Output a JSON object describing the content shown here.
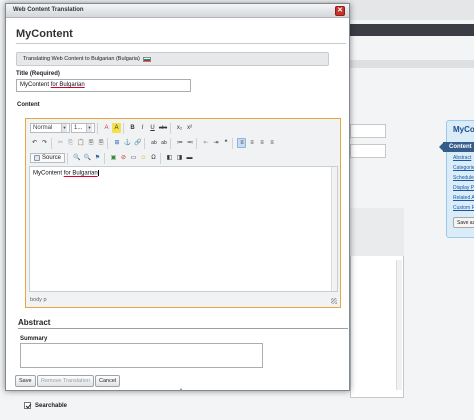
{
  "dialog": {
    "title": "Web Content Translation",
    "close_glyph": "✕",
    "heading": "MyContent",
    "info_text": "Translating Web Content to Bulgarian (Bulgaria)",
    "title_label": "Title (Required)",
    "title_value_prefix": "MyContent ",
    "title_value_underlined": "for Bulgarian",
    "content_label": "Content"
  },
  "editor": {
    "format_combo": "Normal",
    "size_combo": "1...",
    "source_label": "Source",
    "body_prefix": "MyContent ",
    "body_underlined": "for Bulgarian",
    "elements_path": "body  p",
    "toolbar_row1": [
      "A",
      "A",
      "B",
      "I",
      "U",
      "abc",
      "x₂",
      "x²"
    ],
    "toolbar_row2": [
      "↶",
      "↷",
      "✂",
      "⎘",
      "📋",
      "🗎",
      "🗎",
      "⊞",
      "⚓",
      "🔗",
      "ab",
      "ab",
      "≔",
      "≕",
      "⇤",
      "⇥",
      "❝",
      "≡",
      "≡",
      "≡",
      "≡"
    ],
    "toolbar_row3": [
      "🔍",
      "🔍",
      "⚑",
      "▣",
      "⊘",
      "▭",
      "☺",
      "Ω",
      "◧",
      "◨",
      "▬"
    ]
  },
  "abstract": {
    "title": "Abstract",
    "summary_label": "Summary",
    "summary_value": ""
  },
  "buttons": {
    "save": "Save",
    "remove_translation": "Remove Translation",
    "cancel": "Cancel"
  },
  "background": {
    "searchable_label": "Searchable",
    "side_panel_title": "MyCont",
    "side_active": "Content",
    "side_links": [
      "Abstract",
      "Categories",
      "Schedule",
      "Display Pa",
      "Related A",
      "Custom F"
    ],
    "side_save": "Save as"
  },
  "colors": {
    "editor_focus_border": "#e4a83c",
    "close_button": "#c7322c",
    "side_panel_bg": "#d9ecf8",
    "link": "#1a56a6"
  }
}
